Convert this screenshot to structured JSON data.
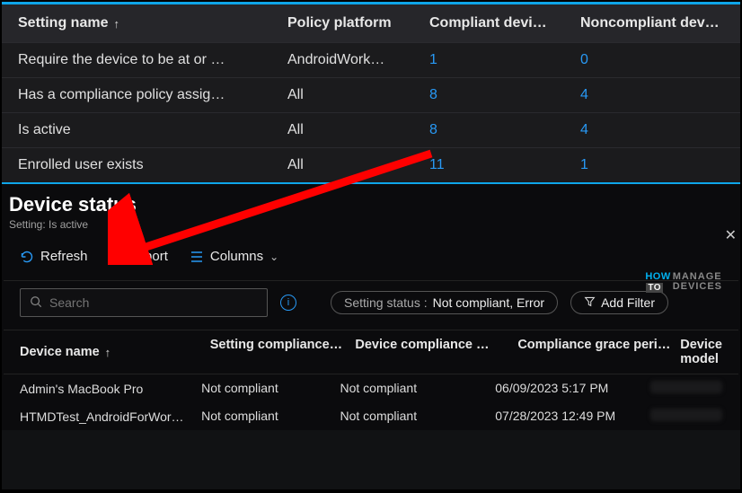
{
  "topTable": {
    "headers": {
      "settingName": "Setting name",
      "policyPlatform": "Policy platform",
      "compliant": "Compliant devi…",
      "noncompliant": "Noncompliant dev…"
    },
    "rows": [
      {
        "name": "Require the device to be at or …",
        "platform": "AndroidWork…",
        "compliant": "1",
        "noncompliant": "0"
      },
      {
        "name": "Has a compliance policy assig…",
        "platform": "All",
        "compliant": "8",
        "noncompliant": "4"
      },
      {
        "name": "Is active",
        "platform": "All",
        "compliant": "8",
        "noncompliant": "4"
      },
      {
        "name": "Enrolled user exists",
        "platform": "All",
        "compliant": "11",
        "noncompliant": "1"
      }
    ]
  },
  "detail": {
    "title": "Device status",
    "subtitle": "Setting: Is active",
    "toolbar": {
      "refresh": "Refresh",
      "export": "Export",
      "columns": "Columns"
    },
    "search_placeholder": "Search",
    "filter_label": "Setting status :",
    "filter_value": "Not compliant, Error",
    "add_filter": "Add Filter",
    "grid_headers": {
      "deviceName": "Device name",
      "settingCompliance": "Setting compliance…",
      "deviceCompliance": "Device compliance …",
      "gracePeriod": "Compliance grace peri…",
      "deviceModel": "Device model"
    },
    "grid_rows": [
      {
        "deviceName": "Admin's MacBook Pro",
        "settingCompliance": "Not compliant",
        "deviceCompliance": "Not compliant",
        "grace": "06/09/2023 5:17 PM"
      },
      {
        "deviceName": "HTMDTest_AndroidForWor…",
        "settingCompliance": "Not compliant",
        "deviceCompliance": "Not compliant",
        "grace": "07/28/2023 12:49 PM"
      }
    ]
  },
  "logo": {
    "how": "HOW",
    "to": "TO",
    "line1": "MANAGE",
    "line2": "DEVICES"
  }
}
